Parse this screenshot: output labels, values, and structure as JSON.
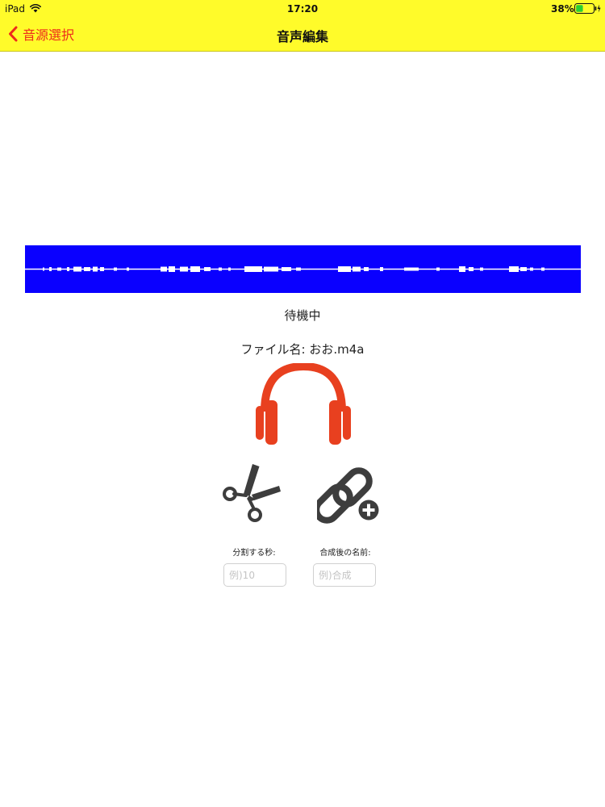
{
  "status_bar": {
    "device": "iPad",
    "time": "17:20",
    "battery": "38%"
  },
  "nav": {
    "back_label": "音源選択",
    "title": "音声編集"
  },
  "player": {
    "status": "待機中",
    "file_name_label": "ファイル名: おお.m4a"
  },
  "split": {
    "label": "分割する秒:",
    "value": "",
    "placeholder": "例)10"
  },
  "merge": {
    "label": "合成後の名前:",
    "value": "",
    "placeholder": "例)合成"
  },
  "colors": {
    "nav_background": "#fffb2a",
    "accent": "#ee2a1b",
    "waveform_background": "#0a00ff",
    "waveform_line": "#ffffff",
    "headphones": "#e8401f",
    "tool_icons": "#3d3d3d"
  },
  "icons": {
    "wifi": "wifi-icon",
    "battery": "battery-icon",
    "back": "chevron-left-icon",
    "play": "headphones-icon",
    "split": "scissors-icon",
    "merge": "link-add-icon"
  }
}
